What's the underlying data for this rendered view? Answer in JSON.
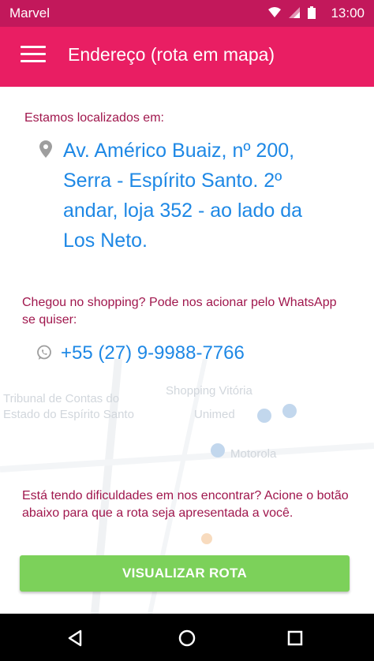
{
  "status_bar": {
    "carrier": "Marvel",
    "time": "13:00",
    "icons": [
      "wifi-icon",
      "signal-icon",
      "battery-icon"
    ]
  },
  "app_bar": {
    "title": "Endereço (rota em mapa)",
    "menu_icon": "hamburger-menu-icon"
  },
  "location": {
    "intro": "Estamos localizados em:",
    "address": "Av. Américo Buaiz, nº 200, Serra - Espírito Santo. 2º andar, loja 352 - ao lado da Los Neto.",
    "pin_icon": "location-pin-icon"
  },
  "whatsapp": {
    "prompt": "Chegou no shopping? Pode nos acionar pelo WhatsApp se quiser:",
    "phone": "+55 (27) 9-9988-7766",
    "icon": "whatsapp-icon"
  },
  "help": {
    "text": "Está tendo dificuldades em nos encontrar? Acione o botão abaixo para que a rota seja apresentada a você.",
    "button_label": "VISUALIZAR ROTA"
  },
  "map_labels": {
    "label_1": "Tribunal de Contas do",
    "label_2": "Estado do Espírito Santo",
    "label_3": "Shopping Vitória",
    "label_4": "Unimed",
    "label_5": "Motorola"
  },
  "colors": {
    "status_bar": "#c2185b",
    "app_bar": "#e91e63",
    "accent_text": "#a0174d",
    "link_blue": "#1e88e5",
    "button_green": "#7cd15a"
  },
  "nav_bar": {
    "buttons": [
      "back-icon",
      "home-icon",
      "recents-icon"
    ]
  }
}
